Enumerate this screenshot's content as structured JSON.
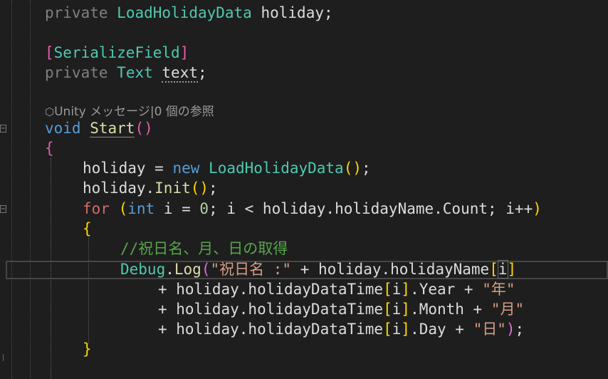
{
  "codelens": {
    "icon": "unity-cube-icon",
    "text": "Unity メッセージ|0 個の参照"
  },
  "code": {
    "l1": {
      "mod": "private",
      "type": "LoadHolidayData",
      "name": "holiday",
      "semi": ";"
    },
    "l2": {
      "open": "[",
      "attr": "SerializeField",
      "close": "]"
    },
    "l3": {
      "mod": "private",
      "type": "Text",
      "name": "text",
      "semi": ";"
    },
    "l4": {
      "kw": "void",
      "fn": "Start",
      "open": "(",
      "close": ")"
    },
    "l5": {
      "brace": "{"
    },
    "l6": {
      "var": "holiday",
      "op": " = ",
      "kw": "new",
      "cls": "LoadHolidayData",
      "open": "(",
      "close": ")",
      "semi": ";"
    },
    "l7": {
      "var": "holiday.",
      "fn": "Init",
      "open": "(",
      "close": ")",
      "semi": ";"
    },
    "l8": {
      "kw": "for",
      "open": "(",
      "type": "int",
      "rest1": " i = ",
      "num": "0",
      "rest2": "; i < holiday.holidayName.Count; i++",
      "close": ")"
    },
    "l9": {
      "brace": "{"
    },
    "l10": {
      "comment": "//祝日名、月、日の取得"
    },
    "l11": {
      "cls": "Debug",
      "dot": ".",
      "fn": "Log",
      "open": "(",
      "str": "\"祝日名 :\"",
      "rest": " + holiday.holidayName",
      "bopen": "[",
      "idx": "i",
      "bclose": "]"
    },
    "l12": {
      "pre": "+ holiday.holidayDataTime",
      "bopen": "[",
      "idx": "i",
      "bclose": "]",
      "mid": ".Year + ",
      "str": "\"年\""
    },
    "l13": {
      "pre": "+ holiday.holidayDataTime",
      "bopen": "[",
      "idx": "i",
      "bclose": "]",
      "mid": ".Month + ",
      "str": "\"月\""
    },
    "l14": {
      "pre": "+ holiday.holidayDataTime",
      "bopen": "[",
      "idx": "i",
      "bclose": "]",
      "mid": ".Day + ",
      "str": "\"日\"",
      "close": ")",
      "semi": ";"
    },
    "l15": {
      "brace": "}"
    }
  },
  "colors": {
    "background": "#1e1e1e",
    "keyword": "#569cd6",
    "type": "#4ec9b0",
    "method": "#dcdcaa",
    "string": "#d69d85",
    "comment": "#57a64a",
    "control": "#d8a0df"
  }
}
